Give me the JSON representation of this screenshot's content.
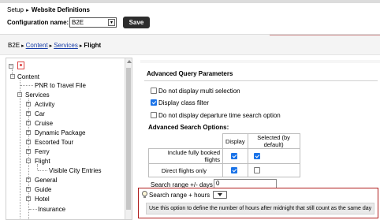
{
  "header": {
    "setup": "Setup",
    "page_title": "Website Definitions",
    "config_label": "Configuration name:",
    "config_value": "B2E",
    "save_label": "Save"
  },
  "breadcrumb": {
    "root": "B2E",
    "content": "Content",
    "services": "Services",
    "current": "Flight"
  },
  "tree": {
    "content": "Content",
    "pnr": "PNR to Travel File",
    "services": "Services",
    "activity": "Activity",
    "car": "Car",
    "cruise": "Cruise",
    "dynamic_package": "Dynamic Package",
    "escorted_tour": "Escorted Tour",
    "ferry": "Ferry",
    "flight": "Flight",
    "visible_city_entries": "Visible City Entries",
    "general": "General",
    "guide": "Guide",
    "hotel": "Hotel",
    "insurance": "Insurance"
  },
  "main": {
    "section_title": "Advanced Query Parameters",
    "opt_multi": {
      "label": "Do not display multi selection",
      "checked": false
    },
    "opt_class": {
      "label": "Display class filter",
      "checked": true
    },
    "opt_departure": {
      "label": "Do not display departure time search option",
      "checked": false
    },
    "adv_title": "Advanced Search Options:",
    "table": {
      "col_display": "Display",
      "col_selected": "Selected (by default)",
      "rows": [
        {
          "label": "Include fully booked flights",
          "display": true,
          "selected": true
        },
        {
          "label": "Direct flights only",
          "display": true,
          "selected": false
        }
      ]
    },
    "range_label": "Search range +/- days",
    "range_value": "0",
    "hours_label": "Search range + hours",
    "hint": "Use this option to define the number of hours after midnight that still count as the same day"
  }
}
